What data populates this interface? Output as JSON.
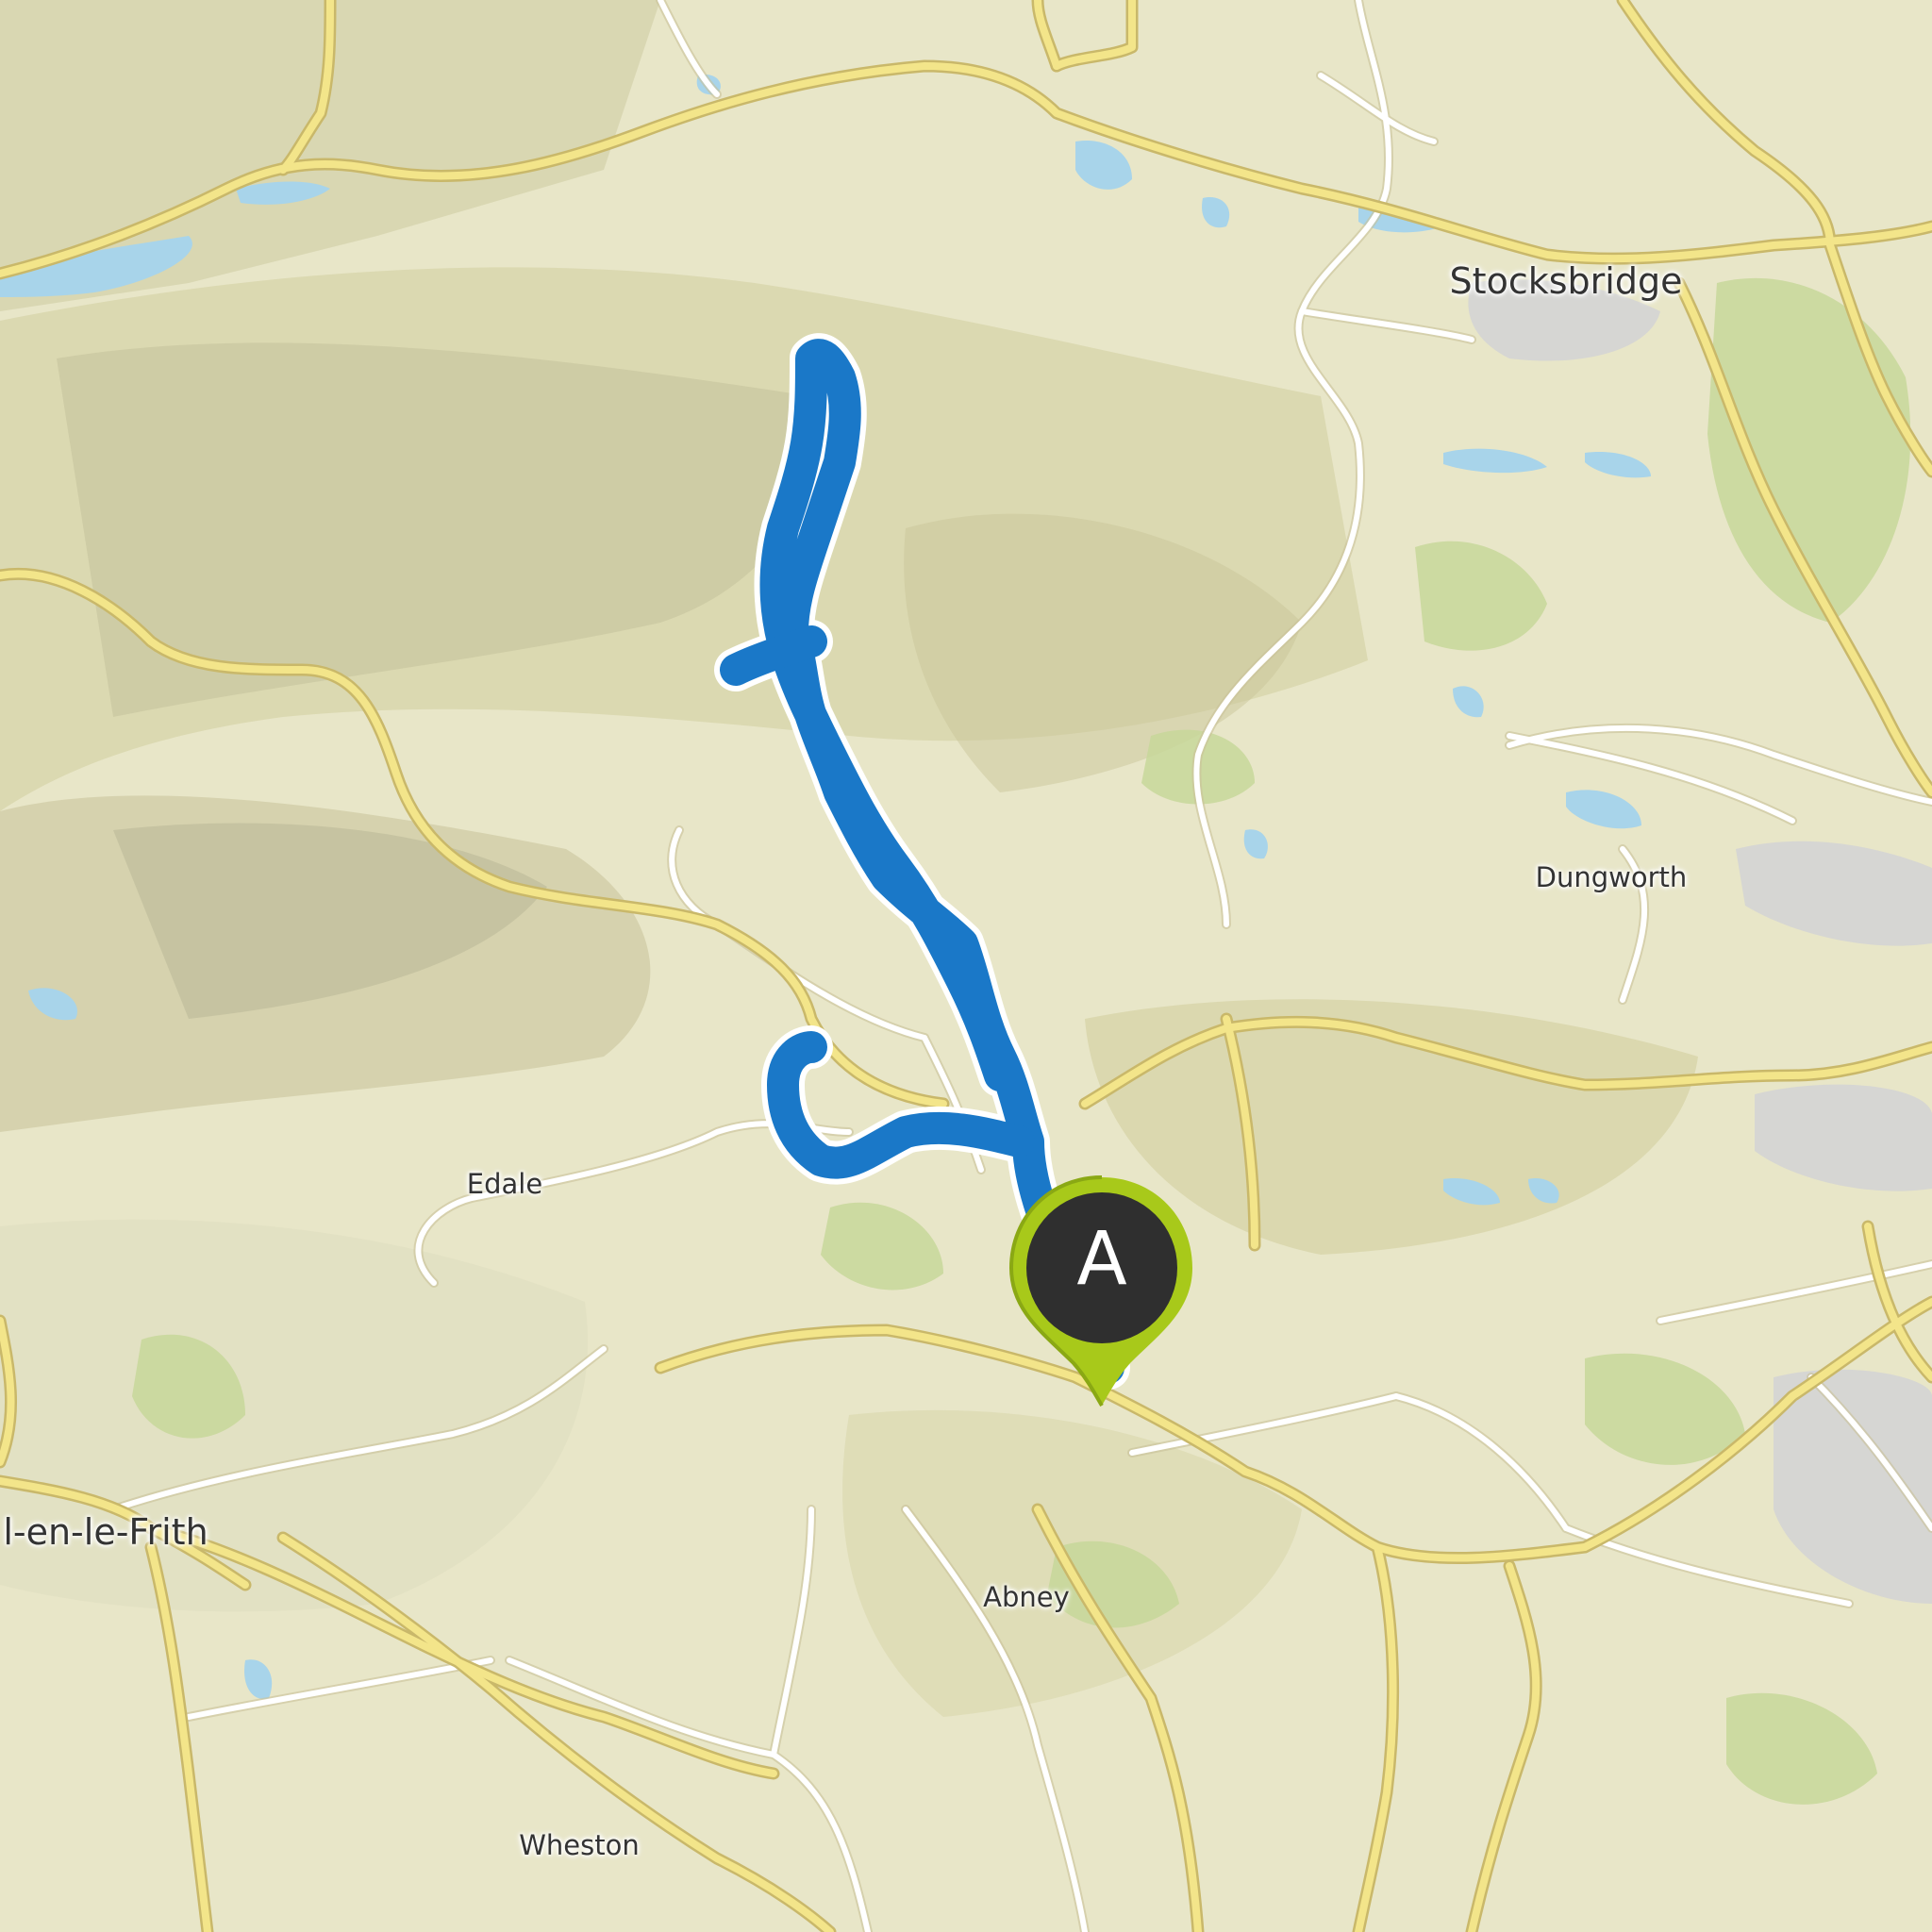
{
  "map": {
    "colors": {
      "land": "#e8e6c8",
      "hill": "#d9d6a8",
      "shadow": "#a9a88a",
      "woodland": "#c7d79a",
      "urban": "#d4d4d4",
      "water": "#a8d4ea",
      "major_road": "#f3e58a",
      "minor_road": "#ffffff",
      "road_casing": "#c9c29a",
      "route": "#1a78c8",
      "route_outline": "#ffffff",
      "marker_fill": "#2f2f2f",
      "marker_ring": "#a8c91a"
    },
    "route_style": "thick-line-with-white-outline"
  },
  "place_labels": {
    "stocksbridge": "Stocksbridge",
    "dungworth": "Dungworth",
    "edale": "Edale",
    "chapel": "l-en-le-Frith",
    "abney": "Abney",
    "wheston": "Wheston"
  },
  "marker": {
    "label": "A",
    "icon": "map-pin-icon"
  }
}
